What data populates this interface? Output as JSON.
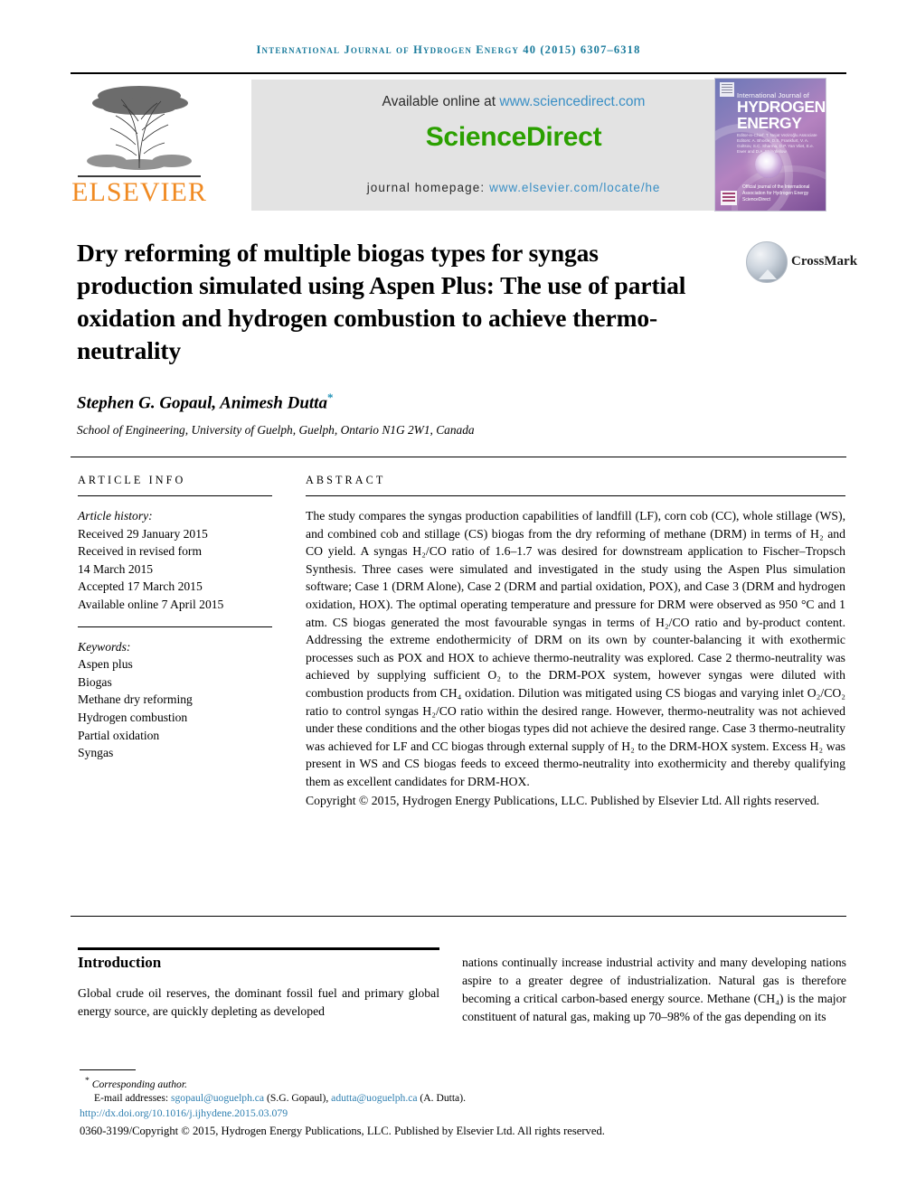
{
  "running_head": "International Journal of Hydrogen Energy 40 (2015) 6307–6318",
  "masthead": {
    "publisher_name": "ELSEVIER",
    "available_online_prefix": "Available online at ",
    "available_online_link": "www.sciencedirect.com",
    "sciencedirect_logo": "ScienceDirect",
    "homepage_prefix": "journal homepage: ",
    "homepage_link": "www.elsevier.com/locate/he",
    "cover": {
      "line1": "International Journal of",
      "line2": "HYDROGEN ENERGY",
      "editors": "Editor-in-Chief: T. Nejat Veziroğlu   Associate Editors: A. Bhosle, D.S. Frankfurt, V. A. Goltsov, S.C. Sharma, D.P. Yan Vliet, E.e. Ewer and D.A. Stringfellow",
      "footer": "Official journal of the International Association for Hydrogen Energy  ScienceDirect"
    }
  },
  "article": {
    "title": "Dry reforming of multiple biogas types for syngas production simulated using Aspen Plus: The use of partial oxidation and hydrogen combustion to achieve thermo-neutrality",
    "crossmark_label": "CrossMark",
    "authors": "Stephen G. Gopaul, Animesh Dutta",
    "corresponding_marker": "*",
    "affiliation": "School of Engineering, University of Guelph, Guelph, Ontario N1G 2W1, Canada"
  },
  "article_info": {
    "heading": "Article info",
    "history_label": "Article history:",
    "history": [
      "Received 29 January 2015",
      "Received in revised form",
      "14 March 2015",
      "Accepted 17 March 2015",
      "Available online 7 April 2015"
    ],
    "keywords_label": "Keywords:",
    "keywords": [
      "Aspen plus",
      "Biogas",
      "Methane dry reforming",
      "Hydrogen combustion",
      "Partial oxidation",
      "Syngas"
    ]
  },
  "abstract": {
    "heading": "Abstract",
    "body": "The study compares the syngas production capabilities of landfill (LF), corn cob (CC), whole stillage (WS), and combined cob and stillage (CS) biogas from the dry reforming of methane (DRM) in terms of H₂ and CO yield. A syngas H₂/CO ratio of 1.6–1.7 was desired for downstream application to Fischer–Tropsch Synthesis. Three cases were simulated and investigated in the study using the Aspen Plus simulation software; Case 1 (DRM Alone), Case 2 (DRM and partial oxidation, POX), and Case 3 (DRM and hydrogen oxidation, HOX). The optimal operating temperature and pressure for DRM were observed as 950 °C and 1 atm. CS biogas generated the most favourable syngas in terms of H₂/CO ratio and by-product content. Addressing the extreme endothermicity of DRM on its own by counter-balancing it with exothermic processes such as POX and HOX to achieve thermo-neutrality was explored. Case 2 thermo-neutrality was achieved by supplying sufficient O₂ to the DRM-POX system, however syngas were diluted with combustion products from CH₄ oxidation. Dilution was mitigated using CS biogas and varying inlet O₂/CO₂ ratio to control syngas H₂/CO ratio within the desired range. However, thermo-neutrality was not achieved under these conditions and the other biogas types did not achieve the desired range. Case 3 thermo-neutrality was achieved for LF and CC biogas through external supply of H₂ to the DRM-HOX system. Excess H₂ was present in WS and CS biogas feeds to exceed thermo-neutrality into exothermicity and thereby qualifying them as excellent candidates for DRM-HOX.",
    "copyright": "Copyright © 2015, Hydrogen Energy Publications, LLC. Published by Elsevier Ltd. All rights reserved."
  },
  "introduction": {
    "heading": "Introduction",
    "column_left": "Global crude oil reserves, the dominant fossil fuel and primary global energy source, are quickly depleting as developed",
    "column_right": "nations continually increase industrial activity and many developing nations aspire to a greater degree of industrialization. Natural gas is therefore becoming a critical carbon-based energy source. Methane (CH₄) is the major constituent of natural gas, making up 70–98% of the gas depending on its"
  },
  "footer": {
    "corresponding": "Corresponding author.",
    "corresponding_marker": "*",
    "email_label": "E-mail addresses: ",
    "email1": "sgopaul@uoguelph.ca",
    "email1_name": " (S.G. Gopaul), ",
    "email2": "adutta@uoguelph.ca",
    "email2_name": " (A. Dutta).",
    "doi": "http://dx.doi.org/10.1016/j.ijhydene.2015.03.079",
    "issn_line": "0360-3199/Copyright © 2015, Hydrogen Energy Publications, LLC. Published by Elsevier Ltd. All rights reserved."
  },
  "colors": {
    "running_head": "#1a7b9c",
    "elsevier_orange": "#f08a22",
    "sciencedirect_green": "#2ba000",
    "link_blue": "#3a8fc5",
    "footer_link": "#2e7fb0"
  }
}
